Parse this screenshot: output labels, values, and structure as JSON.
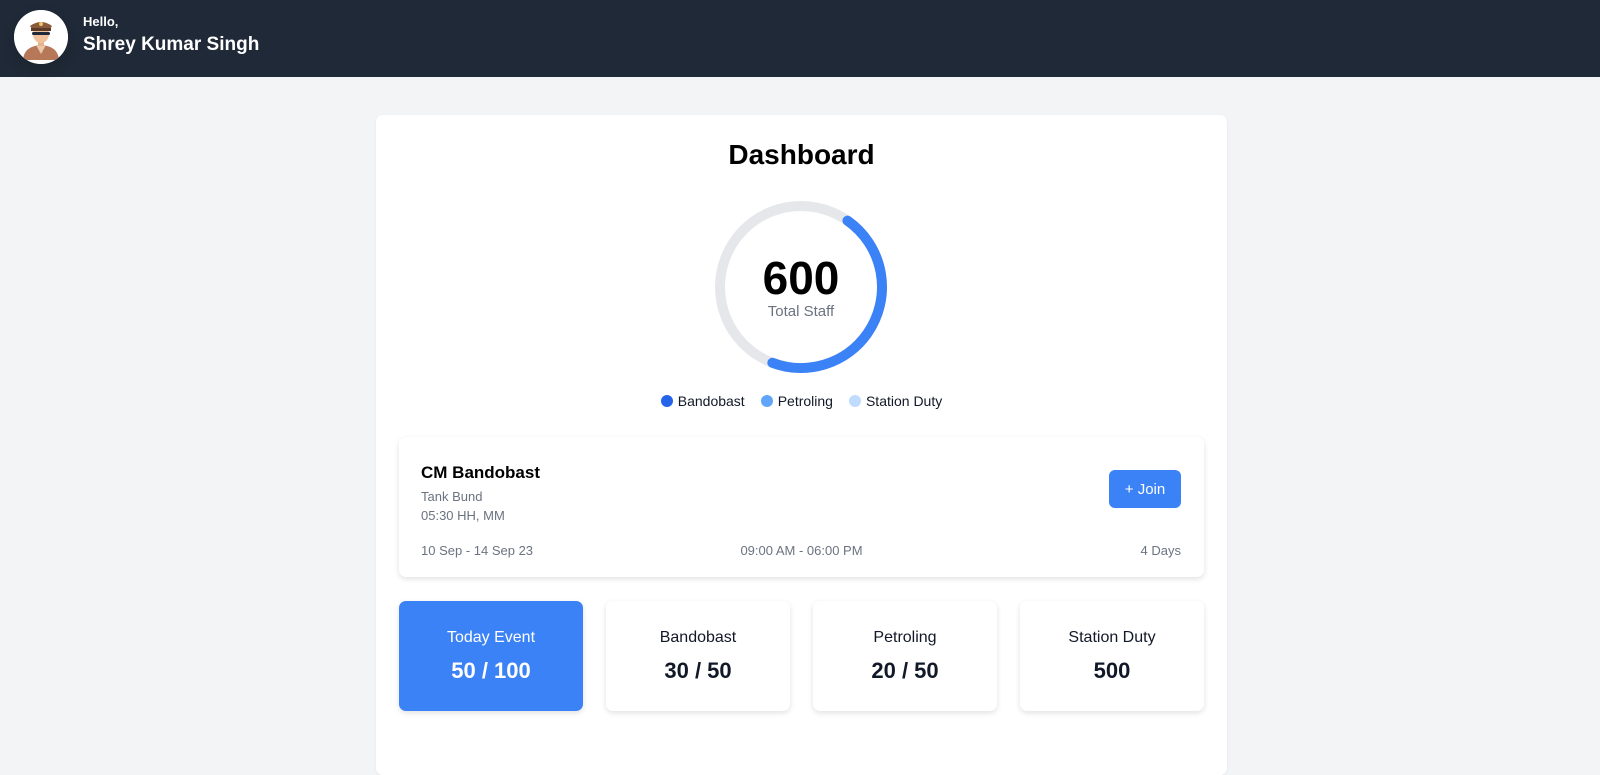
{
  "header": {
    "greeting": "Hello,",
    "user_name": "Shrey Kumar Singh",
    "avatar_icon": "police-officer-avatar-icon"
  },
  "dashboard": {
    "title": "Dashboard",
    "total_value": "600",
    "total_label": "Total Staff",
    "ring_fill_fraction": 0.46,
    "legend": [
      {
        "label": "Bandobast",
        "color": "#2563eb"
      },
      {
        "label": "Petroling",
        "color": "#60a5fa"
      },
      {
        "label": "Station Duty",
        "color": "#bfdbfe"
      }
    ]
  },
  "event": {
    "name": "CM Bandobast",
    "location": "Tank Bund",
    "time": "05:30 HH, MM",
    "join_label": "+ Join",
    "dates": "10 Sep - 14 Sep 23",
    "hours": "09:00 AM - 06:00 PM",
    "duration": "4 Days"
  },
  "stats": [
    {
      "label": "Today Event",
      "value": "50 / 100"
    },
    {
      "label": "Bandobast",
      "value": "30 / 50"
    },
    {
      "label": "Petroling",
      "value": "20 / 50"
    },
    {
      "label": "Station Duty",
      "value": "500"
    }
  ],
  "colors": {
    "header_bg": "#1f2937",
    "accent": "#3b82f6",
    "ring_track": "#e5e7eb"
  }
}
